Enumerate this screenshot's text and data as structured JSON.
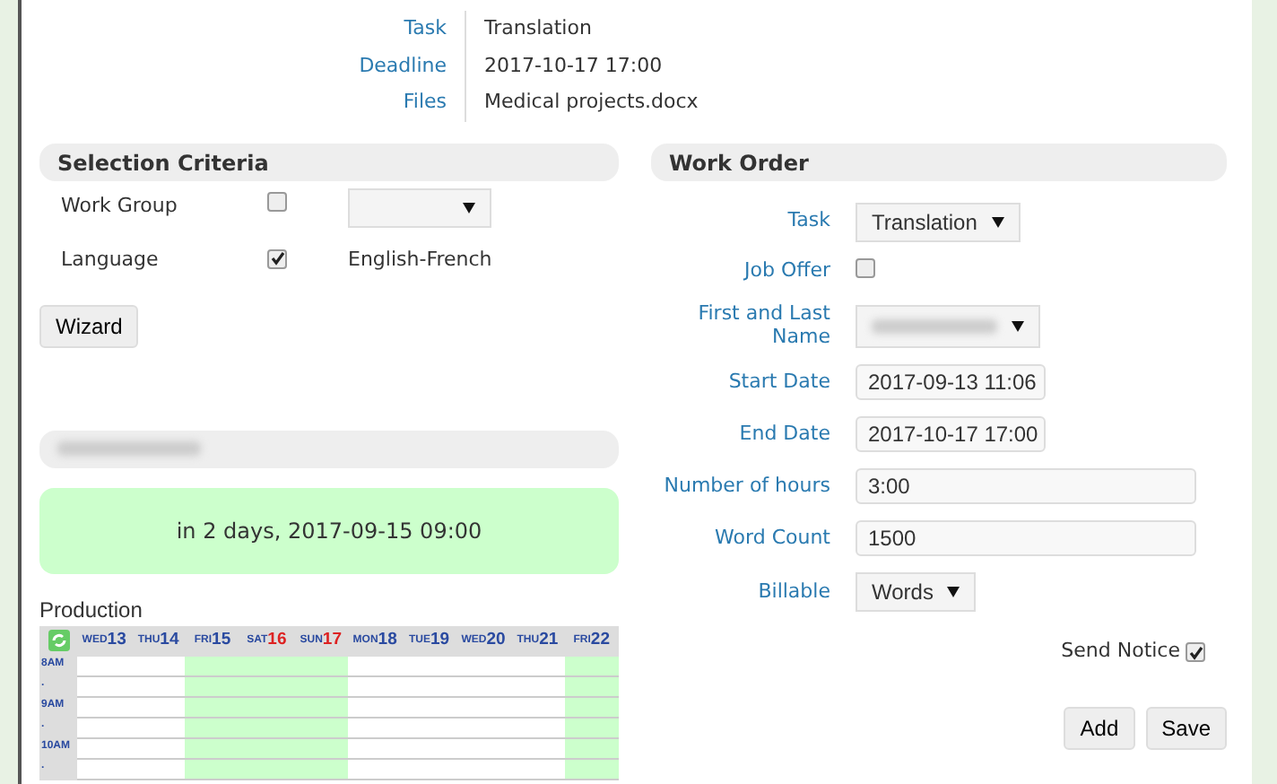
{
  "info": [
    {
      "label": "Task",
      "value": "Translation"
    },
    {
      "label": "Deadline",
      "value": "2017-10-17 17:00"
    },
    {
      "label": "Files",
      "value": "Medical projects.docx"
    }
  ],
  "selection": {
    "title": "Selection Criteria",
    "rows": [
      {
        "label": "Work Group",
        "checked": false,
        "kind": "select",
        "value": ""
      },
      {
        "label": "Language",
        "checked": true,
        "kind": "text",
        "value": "English-French"
      }
    ],
    "button": "Wizard"
  },
  "resource": {
    "notice": "in 2 days, 2017-09-15 09:00"
  },
  "production": {
    "title": "Production",
    "days": [
      {
        "dow": "WED",
        "num": "13",
        "weekend": false,
        "highlighted": false
      },
      {
        "dow": "THU",
        "num": "14",
        "weekend": false,
        "highlighted": false
      },
      {
        "dow": "FRI",
        "num": "15",
        "weekend": false,
        "highlighted": true
      },
      {
        "dow": "SAT",
        "num": "16",
        "weekend": true,
        "highlighted": true
      },
      {
        "dow": "SUN",
        "num": "17",
        "weekend": true,
        "highlighted": true
      },
      {
        "dow": "MON",
        "num": "18",
        "weekend": false,
        "highlighted": false
      },
      {
        "dow": "TUE",
        "num": "19",
        "weekend": false,
        "highlighted": false
      },
      {
        "dow": "WED",
        "num": "20",
        "weekend": false,
        "highlighted": false
      },
      {
        "dow": "THU",
        "num": "21",
        "weekend": false,
        "highlighted": false
      },
      {
        "dow": "FRI",
        "num": "22",
        "weekend": false,
        "highlighted": true
      }
    ],
    "times": [
      "8AM",
      ".",
      "9AM",
      ".",
      "10AM",
      "."
    ]
  },
  "work_order": {
    "title": "Work Order",
    "fields": [
      {
        "label": "Task",
        "kind": "select",
        "value": "Translation"
      },
      {
        "label": "Job Offer",
        "kind": "checkbox",
        "checked": false
      },
      {
        "label": "First and Last Name",
        "kind": "select-blurred"
      },
      {
        "label": "Start Date",
        "kind": "date",
        "value": "2017-09-13 11:06"
      },
      {
        "label": "End Date",
        "kind": "date",
        "value": "2017-10-17 17:00"
      },
      {
        "label": "Number of hours",
        "kind": "text",
        "value": "3:00"
      },
      {
        "label": "Word Count",
        "kind": "text",
        "value": "1500"
      },
      {
        "label": "Billable",
        "kind": "select",
        "value": "Words"
      }
    ],
    "send_notice": {
      "label": "Send Notice",
      "checked": true
    },
    "buttons": [
      "Add",
      "Save"
    ]
  }
}
